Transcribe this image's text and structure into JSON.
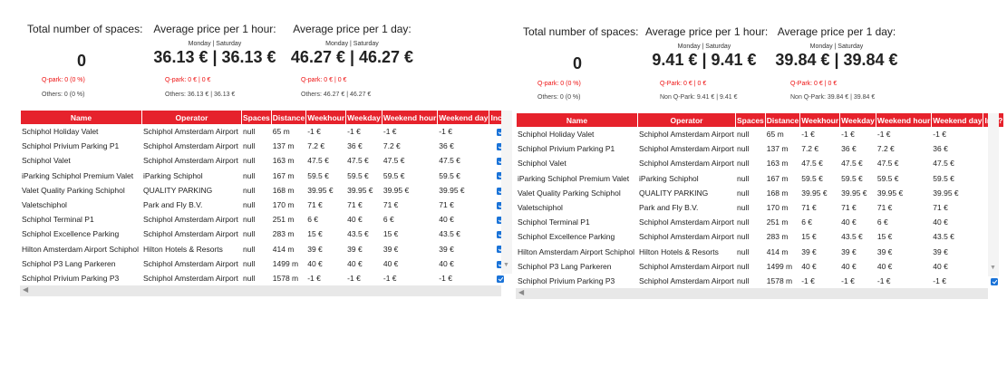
{
  "left": {
    "stats": {
      "spaces_title": "Total number of spaces:",
      "spaces_value": "0",
      "hour_title": "Average price per 1 hour:",
      "hour_days": "Monday | Saturday",
      "hour_value": "36.13 € | 36.13 €",
      "day_title": "Average price per 1 day:",
      "day_days": "Monday | Saturday",
      "day_value": "46.27 € | 46.27 €",
      "spaces_qpark": "Q-park: 0 (0 %)",
      "spaces_others": "Others: 0 (0 %)",
      "hour_qpark": "Q-park: 0 € | 0 €",
      "hour_others": "Others: 36.13 € | 36.13 €",
      "day_qpark": "Q-park: 0 € | 0 €",
      "day_others": "Others: 46.27 € | 46.27 €"
    },
    "rows": [
      {
        "name": "Schiphol Holiday Valet",
        "operator": "Schiphol Amsterdam Airport",
        "spaces": "null",
        "distance": "65 m",
        "weekhour": "-1 €",
        "weekday": "-1 €",
        "weekendhour": "-1 €",
        "weekendday": "-1 €",
        "incl": true
      },
      {
        "name": "Schiphol Privium Parking P1",
        "operator": "Schiphol Amsterdam Airport",
        "spaces": "null",
        "distance": "137 m",
        "weekhour": "7.2 €",
        "weekday": "36 €",
        "weekendhour": "7.2 €",
        "weekendday": "36 €",
        "incl": true
      },
      {
        "name": "Schiphol Valet",
        "operator": "Schiphol Amsterdam Airport",
        "spaces": "null",
        "distance": "163 m",
        "weekhour": "47.5 €",
        "weekday": "47.5 €",
        "weekendhour": "47.5 €",
        "weekendday": "47.5 €",
        "incl": true
      },
      {
        "name": "iParking Schiphol Premium Valet",
        "operator": "iParking Schiphol",
        "spaces": "null",
        "distance": "167 m",
        "weekhour": "59.5 €",
        "weekday": "59.5 €",
        "weekendhour": "59.5 €",
        "weekendday": "59.5 €",
        "incl": true
      },
      {
        "name": "Valet Quality Parking Schiphol",
        "operator": "QUALITY PARKING",
        "spaces": "null",
        "distance": "168 m",
        "weekhour": "39.95 €",
        "weekday": "39.95 €",
        "weekendhour": "39.95 €",
        "weekendday": "39.95 €",
        "incl": true
      },
      {
        "name": "Valetschiphol",
        "operator": "Park and Fly B.V.",
        "spaces": "null",
        "distance": "170 m",
        "weekhour": "71 €",
        "weekday": "71 €",
        "weekendhour": "71 €",
        "weekendday": "71 €",
        "incl": true
      },
      {
        "name": "Schiphol Terminal P1",
        "operator": "Schiphol Amsterdam Airport",
        "spaces": "null",
        "distance": "251 m",
        "weekhour": "6 €",
        "weekday": "40 €",
        "weekendhour": "6 €",
        "weekendday": "40 €",
        "incl": true
      },
      {
        "name": "Schiphol Excellence Parking",
        "operator": "Schiphol Amsterdam Airport",
        "spaces": "null",
        "distance": "283 m",
        "weekhour": "15 €",
        "weekday": "43.5 €",
        "weekendhour": "15 €",
        "weekendday": "43.5 €",
        "incl": true
      },
      {
        "name": "Hilton Amsterdam Airport Schiphol",
        "operator": "Hilton Hotels & Resorts",
        "spaces": "null",
        "distance": "414 m",
        "weekhour": "39 €",
        "weekday": "39 €",
        "weekendhour": "39 €",
        "weekendday": "39 €",
        "incl": true
      },
      {
        "name": "Schiphol P3 Lang Parkeren",
        "operator": "Schiphol Amsterdam Airport",
        "spaces": "null",
        "distance": "1499 m",
        "weekhour": "40 €",
        "weekday": "40 €",
        "weekendhour": "40 €",
        "weekendday": "40 €",
        "incl": true
      },
      {
        "name": "Schiphol Privium Parking P3",
        "operator": "Schiphol Amsterdam Airport",
        "spaces": "null",
        "distance": "1578 m",
        "weekhour": "-1 €",
        "weekday": "-1 €",
        "weekendhour": "-1 €",
        "weekendday": "-1 €",
        "incl": true
      }
    ]
  },
  "right": {
    "stats": {
      "spaces_title": "Total number of spaces:",
      "spaces_value": "0",
      "hour_title": "Average price per 1 hour:",
      "hour_days": "Monday | Saturday",
      "hour_value": "9.41 € | 9.41 €",
      "day_title": "Average price per 1 day:",
      "day_days": "Monday | Saturday",
      "day_value": "39.84 € | 39.84 €",
      "spaces_qpark": "Q-park: 0 (0 %)",
      "spaces_others": "Others: 0 (0 %)",
      "hour_qpark": "Q-Park: 0 € | 0 €",
      "hour_others": "Non Q-Park: 9.41 € | 9.41 €",
      "day_qpark": "Q-Park: 0 € | 0 €",
      "day_others": "Non Q-Park: 39.84 € | 39.84 €"
    },
    "rows": [
      {
        "name": "Schiphol Holiday Valet",
        "operator": "Schiphol Amsterdam Airport",
        "spaces": "null",
        "distance": "65 m",
        "weekhour": "-1 €",
        "weekday": "-1 €",
        "weekendhour": "-1 €",
        "weekendday": "-1 €",
        "incl": true
      },
      {
        "name": "Schiphol Privium Parking P1",
        "operator": "Schiphol Amsterdam Airport",
        "spaces": "null",
        "distance": "137 m",
        "weekhour": "7.2 €",
        "weekday": "36 €",
        "weekendhour": "7.2 €",
        "weekendday": "36 €",
        "incl": true
      },
      {
        "name": "Schiphol Valet",
        "operator": "Schiphol Amsterdam Airport",
        "spaces": "null",
        "distance": "163 m",
        "weekhour": "47.5 €",
        "weekday": "47.5 €",
        "weekendhour": "47.5 €",
        "weekendday": "47.5 €",
        "incl": false
      },
      {
        "name": "iParking Schiphol Premium Valet",
        "operator": "iParking Schiphol",
        "spaces": "null",
        "distance": "167 m",
        "weekhour": "59.5 €",
        "weekday": "59.5 €",
        "weekendhour": "59.5 €",
        "weekendday": "59.5 €",
        "incl": false
      },
      {
        "name": "Valet Quality Parking Schiphol",
        "operator": "QUALITY PARKING",
        "spaces": "null",
        "distance": "168 m",
        "weekhour": "39.95 €",
        "weekday": "39.95 €",
        "weekendhour": "39.95 €",
        "weekendday": "39.95 €",
        "incl": false
      },
      {
        "name": "Valetschiphol",
        "operator": "Park and Fly B.V.",
        "spaces": "null",
        "distance": "170 m",
        "weekhour": "71 €",
        "weekday": "71 €",
        "weekendhour": "71 €",
        "weekendday": "71 €",
        "incl": false
      },
      {
        "name": "Schiphol Terminal P1",
        "operator": "Schiphol Amsterdam Airport",
        "spaces": "null",
        "distance": "251 m",
        "weekhour": "6 €",
        "weekday": "40 €",
        "weekendhour": "6 €",
        "weekendday": "40 €",
        "incl": true
      },
      {
        "name": "Schiphol Excellence Parking",
        "operator": "Schiphol Amsterdam Airport",
        "spaces": "null",
        "distance": "283 m",
        "weekhour": "15 €",
        "weekday": "43.5 €",
        "weekendhour": "15 €",
        "weekendday": "43.5 €",
        "incl": true
      },
      {
        "name": "Hilton Amsterdam Airport Schiphol",
        "operator": "Hilton Hotels & Resorts",
        "spaces": "null",
        "distance": "414 m",
        "weekhour": "39 €",
        "weekday": "39 €",
        "weekendhour": "39 €",
        "weekendday": "39 €",
        "incl": false
      },
      {
        "name": "Schiphol P3 Lang Parkeren",
        "operator": "Schiphol Amsterdam Airport",
        "spaces": "null",
        "distance": "1499 m",
        "weekhour": "40 €",
        "weekday": "40 €",
        "weekendhour": "40 €",
        "weekendday": "40 €",
        "incl": false
      },
      {
        "name": "Schiphol Privium Parking P3",
        "operator": "Schiphol Amsterdam Airport",
        "spaces": "null",
        "distance": "1578 m",
        "weekhour": "-1 €",
        "weekday": "-1 €",
        "weekendhour": "-1 €",
        "weekendday": "-1 €",
        "incl": true
      }
    ]
  },
  "columns": [
    "Name",
    "Operator",
    "Spaces",
    "Distance",
    "Weekhour",
    "Weekday",
    "Weekend hour",
    "Weekend day",
    "Incl?"
  ],
  "scroll_icons": {
    "up": "▲",
    "down": "▼",
    "left": "◀"
  },
  "colors": {
    "header_bg": "#e6222c",
    "accent_red": "#e11111",
    "checkbox_on": "#1a73d8"
  }
}
